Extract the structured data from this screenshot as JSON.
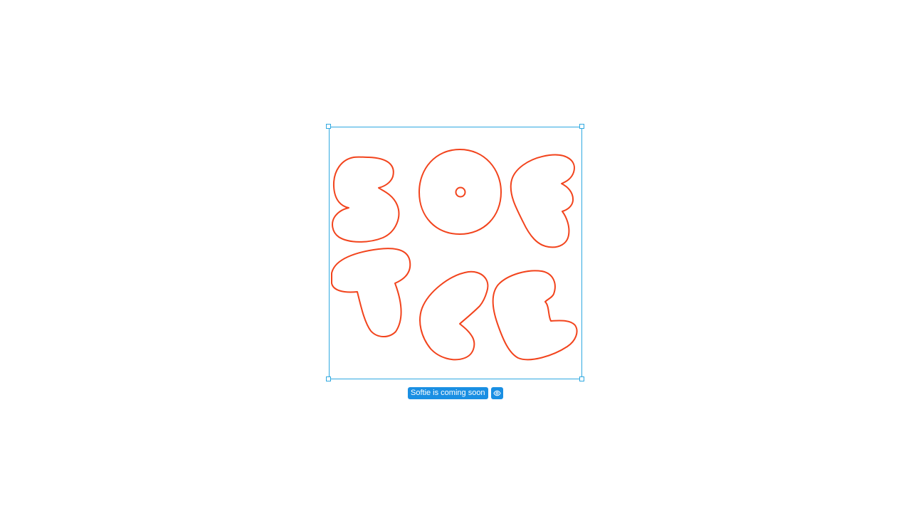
{
  "canvas": {
    "background": "#ffffff"
  },
  "selection": {
    "frame_color": "#2ea8e0",
    "label": "Softie is coming soon",
    "label_background": "#1a8fe3",
    "toggle_icon": "eye-icon"
  },
  "artwork": {
    "stroke_color": "#f2431c",
    "glyphs": [
      "S",
      "O",
      "F",
      "T",
      "I",
      "E"
    ]
  }
}
